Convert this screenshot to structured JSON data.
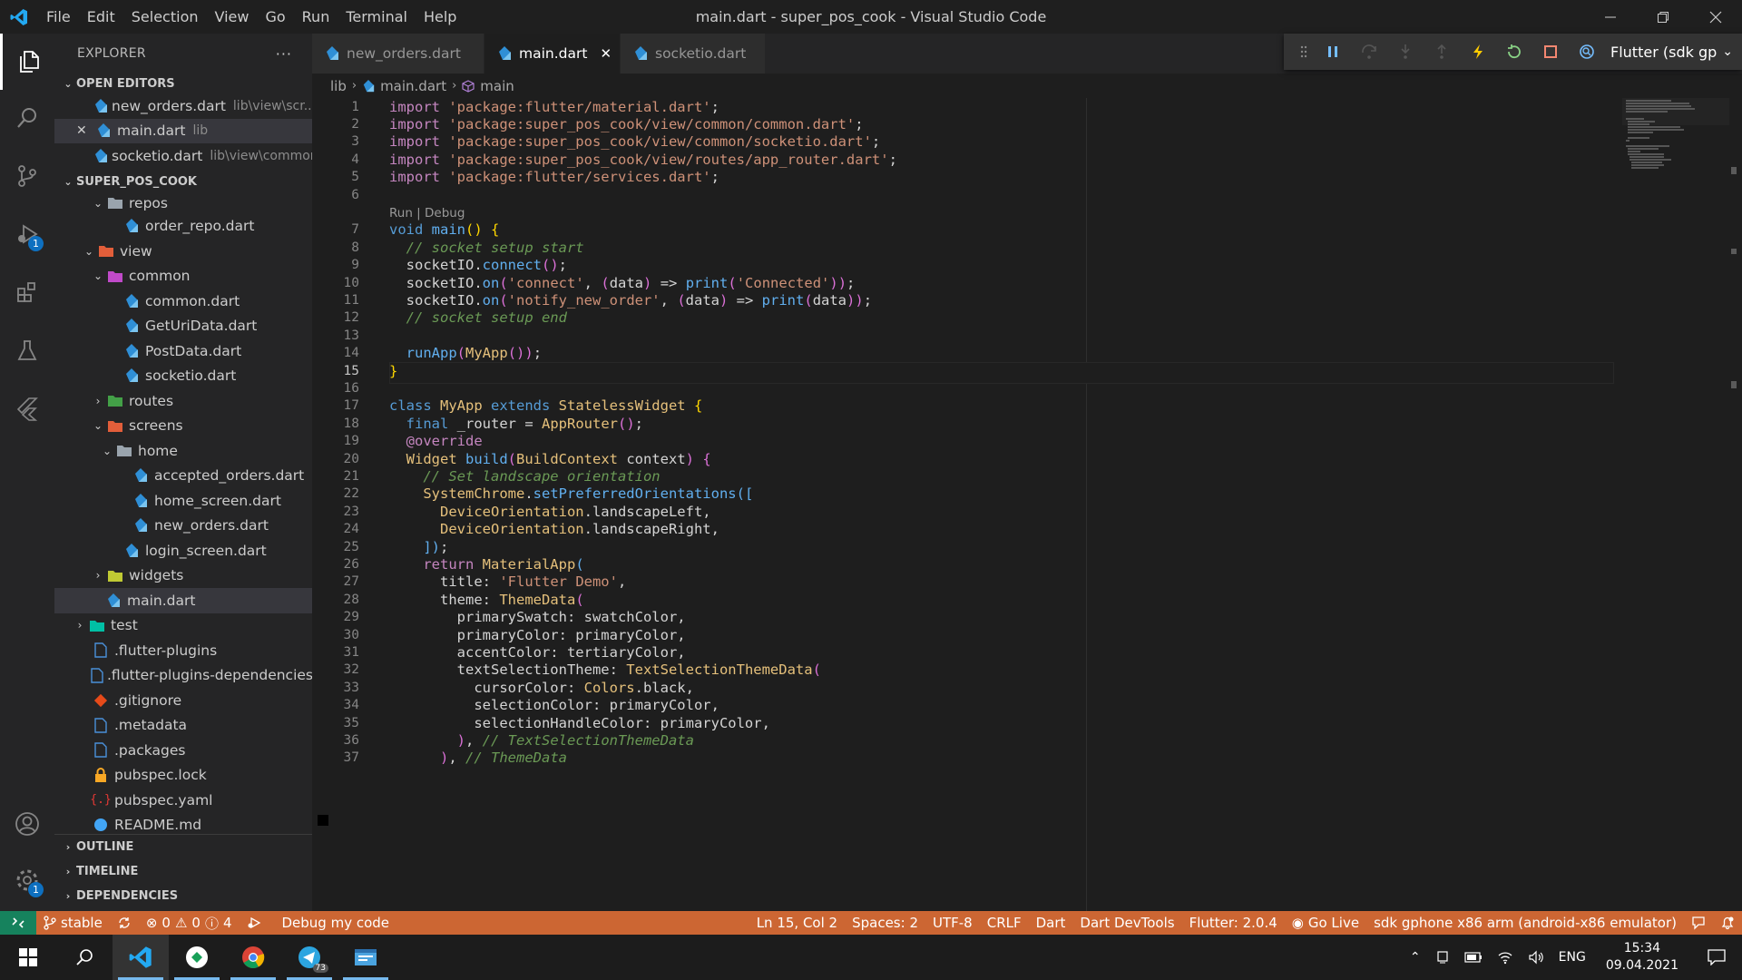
{
  "window": {
    "title": "main.dart - super_pos_cook - Visual Studio Code",
    "menu": [
      "File",
      "Edit",
      "Selection",
      "View",
      "Go",
      "Run",
      "Terminal",
      "Help"
    ]
  },
  "activity": {
    "run_badge": "1",
    "settings_badge": "1"
  },
  "sidebar": {
    "title": "EXPLORER",
    "more": "···",
    "open_editors_label": "OPEN EDITORS",
    "open_editors": [
      {
        "name": "new_orders.dart",
        "desc": "lib\\view\\scr..."
      },
      {
        "name": "main.dart",
        "desc": "lib"
      },
      {
        "name": "socketio.dart",
        "desc": "lib\\view\\common"
      }
    ],
    "project_label": "SUPER_POS_COOK",
    "tree": [
      {
        "label": "repos"
      },
      {
        "label": "order_repo.dart"
      },
      {
        "label": "view"
      },
      {
        "label": "common"
      },
      {
        "label": "common.dart"
      },
      {
        "label": "GetUriData.dart"
      },
      {
        "label": "PostData.dart"
      },
      {
        "label": "socketio.dart"
      },
      {
        "label": "routes"
      },
      {
        "label": "screens"
      },
      {
        "label": "home"
      },
      {
        "label": "accepted_orders.dart"
      },
      {
        "label": "home_screen.dart"
      },
      {
        "label": "new_orders.dart"
      },
      {
        "label": "login_screen.dart"
      },
      {
        "label": "widgets"
      },
      {
        "label": "main.dart"
      },
      {
        "label": "test"
      },
      {
        "label": ".flutter-plugins"
      },
      {
        "label": ".flutter-plugins-dependencies"
      },
      {
        "label": ".gitignore"
      },
      {
        "label": ".metadata"
      },
      {
        "label": ".packages"
      },
      {
        "label": "pubspec.lock"
      },
      {
        "label": "pubspec.yaml"
      },
      {
        "label": "README.md"
      }
    ],
    "outline_label": "OUTLINE",
    "timeline_label": "TIMELINE",
    "dependencies_label": "DEPENDENCIES"
  },
  "tabs": [
    {
      "label": "new_orders.dart"
    },
    {
      "label": "main.dart"
    },
    {
      "label": "socketio.dart"
    }
  ],
  "debug": {
    "target": "Flutter (sdk gp"
  },
  "breadcrumb": {
    "folder": "lib",
    "file": "main.dart",
    "symbol": "main"
  },
  "editor": {
    "codelens": "Run | Debug",
    "current_line": 15,
    "lines": [
      {
        "n": "1",
        "tokens": [
          [
            "kw",
            "import "
          ],
          [
            "str",
            "'package:flutter/material.dart'"
          ],
          [
            "id",
            ";"
          ]
        ]
      },
      {
        "n": "2",
        "tokens": [
          [
            "kw",
            "import "
          ],
          [
            "str",
            "'package:super_pos_cook/view/common/common.dart'"
          ],
          [
            "id",
            ";"
          ]
        ]
      },
      {
        "n": "3",
        "tokens": [
          [
            "kw",
            "import "
          ],
          [
            "str",
            "'package:super_pos_cook/view/common/socketio.dart'"
          ],
          [
            "id",
            ";"
          ]
        ]
      },
      {
        "n": "4",
        "tokens": [
          [
            "kw",
            "import "
          ],
          [
            "str",
            "'package:super_pos_cook/view/routes/app_router.dart'"
          ],
          [
            "id",
            ";"
          ]
        ]
      },
      {
        "n": "5",
        "tokens": [
          [
            "kw",
            "import "
          ],
          [
            "str",
            "'package:flutter/services.dart'"
          ],
          [
            "id",
            ";"
          ]
        ]
      },
      {
        "n": "6",
        "tokens": []
      },
      {
        "n": "7",
        "tokens": [
          [
            "kb",
            "void "
          ],
          [
            "fn2",
            "main"
          ],
          [
            "br",
            "()"
          ],
          [
            "id",
            " "
          ],
          [
            "br",
            "{"
          ]
        ]
      },
      {
        "n": "8",
        "tokens": [
          [
            "id",
            "  "
          ],
          [
            "cm",
            "// socket setup start"
          ]
        ]
      },
      {
        "n": "9",
        "tokens": [
          [
            "id",
            "  socketIO."
          ],
          [
            "fn2",
            "connect"
          ],
          [
            "br2",
            "()"
          ],
          [
            "id",
            ";"
          ]
        ]
      },
      {
        "n": "10",
        "tokens": [
          [
            "id",
            "  socketIO."
          ],
          [
            "fn2",
            "on"
          ],
          [
            "br2",
            "("
          ],
          [
            "str",
            "'connect'"
          ],
          [
            "id",
            ", "
          ],
          [
            "fn",
            "("
          ],
          [
            "id",
            "data"
          ],
          [
            "fn",
            ")"
          ],
          [
            "id",
            " => "
          ],
          [
            "fn2",
            "print"
          ],
          [
            "fn",
            "("
          ],
          [
            "str",
            "'Connected'"
          ],
          [
            "fn",
            ")"
          ],
          [
            "br2",
            ")"
          ],
          [
            "id",
            ";"
          ]
        ]
      },
      {
        "n": "11",
        "tokens": [
          [
            "id",
            "  socketIO."
          ],
          [
            "fn2",
            "on"
          ],
          [
            "br2",
            "("
          ],
          [
            "str",
            "'notify_new_order'"
          ],
          [
            "id",
            ", "
          ],
          [
            "fn",
            "("
          ],
          [
            "id",
            "data"
          ],
          [
            "fn",
            ")"
          ],
          [
            "id",
            " => "
          ],
          [
            "fn2",
            "print"
          ],
          [
            "fn",
            "("
          ],
          [
            "id",
            "data"
          ],
          [
            "fn",
            ")"
          ],
          [
            "br2",
            ")"
          ],
          [
            "id",
            ";"
          ]
        ]
      },
      {
        "n": "12",
        "tokens": [
          [
            "id",
            "  "
          ],
          [
            "cm",
            "// socket setup end"
          ]
        ]
      },
      {
        "n": "13",
        "tokens": []
      },
      {
        "n": "14",
        "tokens": [
          [
            "id",
            "  "
          ],
          [
            "fn2",
            "runApp"
          ],
          [
            "br2",
            "("
          ],
          [
            "typ2",
            "MyApp"
          ],
          [
            "fn",
            "()"
          ],
          [
            "br2",
            ")"
          ],
          [
            "id",
            ";"
          ]
        ]
      },
      {
        "n": "15",
        "tokens": [
          [
            "br",
            "}"
          ]
        ]
      },
      {
        "n": "16",
        "tokens": []
      },
      {
        "n": "17",
        "tokens": [
          [
            "kb",
            "class "
          ],
          [
            "typ2",
            "MyApp "
          ],
          [
            "kb",
            "extends "
          ],
          [
            "typ2",
            "StatelessWidget "
          ],
          [
            "br",
            "{"
          ]
        ]
      },
      {
        "n": "18",
        "tokens": [
          [
            "id",
            "  "
          ],
          [
            "kb",
            "final "
          ],
          [
            "id",
            "_router = "
          ],
          [
            "typ2",
            "AppRouter"
          ],
          [
            "br2",
            "()"
          ],
          [
            "id",
            ";"
          ]
        ]
      },
      {
        "n": "19",
        "tokens": [
          [
            "id",
            "  "
          ],
          [
            "ann",
            "@override"
          ]
        ]
      },
      {
        "n": "20",
        "tokens": [
          [
            "id",
            "  "
          ],
          [
            "typ2",
            "Widget "
          ],
          [
            "fn2",
            "build"
          ],
          [
            "br2",
            "("
          ],
          [
            "typ2",
            "BuildContext "
          ],
          [
            "id",
            "context"
          ],
          [
            "br2",
            ")"
          ],
          [
            "id",
            " "
          ],
          [
            "br2",
            "{"
          ]
        ]
      },
      {
        "n": "21",
        "tokens": [
          [
            "id",
            "    "
          ],
          [
            "cm",
            "// Set landscape orientation"
          ]
        ]
      },
      {
        "n": "22",
        "tokens": [
          [
            "id",
            "    "
          ],
          [
            "typ2",
            "SystemChrome"
          ],
          [
            "id",
            "."
          ],
          [
            "fn2",
            "setPreferredOrientations"
          ],
          [
            "fn2",
            "(["
          ]
        ]
      },
      {
        "n": "23",
        "tokens": [
          [
            "id",
            "      "
          ],
          [
            "typ2",
            "DeviceOrientation"
          ],
          [
            "id",
            ".landscapeLeft,"
          ]
        ]
      },
      {
        "n": "24",
        "tokens": [
          [
            "id",
            "      "
          ],
          [
            "typ2",
            "DeviceOrientation"
          ],
          [
            "id",
            ".landscapeRight,"
          ]
        ]
      },
      {
        "n": "25",
        "tokens": [
          [
            "id",
            "    "
          ],
          [
            "fn2",
            "])"
          ],
          [
            "id",
            ";"
          ]
        ]
      },
      {
        "n": "26",
        "tokens": [
          [
            "id",
            "    "
          ],
          [
            "kw",
            "return "
          ],
          [
            "typ2",
            "MaterialApp"
          ],
          [
            "fn2",
            "("
          ]
        ]
      },
      {
        "n": "27",
        "tokens": [
          [
            "id",
            "      title: "
          ],
          [
            "str",
            "'Flutter Demo'"
          ],
          [
            "id",
            ","
          ]
        ]
      },
      {
        "n": "28",
        "tokens": [
          [
            "id",
            "      theme: "
          ],
          [
            "typ2",
            "ThemeData"
          ],
          [
            "fn",
            "("
          ]
        ]
      },
      {
        "n": "29",
        "tokens": [
          [
            "id",
            "        primarySwatch: swatchColor,"
          ]
        ]
      },
      {
        "n": "30",
        "tokens": [
          [
            "id",
            "        primaryColor: primaryColor,"
          ]
        ]
      },
      {
        "n": "31",
        "tokens": [
          [
            "id",
            "        accentColor: tertiaryColor,"
          ]
        ]
      },
      {
        "n": "32",
        "tokens": [
          [
            "id",
            "        textSelectionTheme: "
          ],
          [
            "typ2",
            "TextSelectionThemeData"
          ],
          [
            "br2",
            "("
          ]
        ]
      },
      {
        "n": "33",
        "tokens": [
          [
            "id",
            "          cursorColor: "
          ],
          [
            "typ2",
            "Colors"
          ],
          [
            "id",
            ".black,"
          ]
        ]
      },
      {
        "n": "34",
        "tokens": [
          [
            "id",
            "          selectionColor: primaryColor,"
          ]
        ]
      },
      {
        "n": "35",
        "tokens": [
          [
            "id",
            "          selectionHandleColor: primaryColor,"
          ]
        ]
      },
      {
        "n": "36",
        "tokens": [
          [
            "id",
            "        "
          ],
          [
            "br2",
            ")"
          ],
          [
            "id",
            ", "
          ],
          [
            "cm2",
            "// TextSelectionThemeData"
          ]
        ]
      },
      {
        "n": "37",
        "tokens": [
          [
            "id",
            "      "
          ],
          [
            "fn",
            ")"
          ],
          [
            "id",
            ", "
          ],
          [
            "cm2",
            "// ThemeData"
          ]
        ]
      }
    ]
  },
  "status": {
    "branch": "stable",
    "errors": "0",
    "warnings": "0",
    "infos": "4",
    "debug": "Debug my code",
    "position": "Ln 15, Col 2",
    "spaces": "Spaces: 2",
    "encoding": "UTF-8",
    "eol": "CRLF",
    "language": "Dart",
    "devtools": "Dart DevTools",
    "flutter": "Flutter: 2.0.4",
    "golive": "Go Live",
    "device": "sdk gphone x86 arm (android-x86 emulator)"
  },
  "taskbar": {
    "telegram_badge": "73",
    "lang": "ENG",
    "time": "15:34",
    "date": "09.04.2021"
  },
  "colors": {
    "statusbar": "#cc6633",
    "accent": "#0e70c0"
  }
}
